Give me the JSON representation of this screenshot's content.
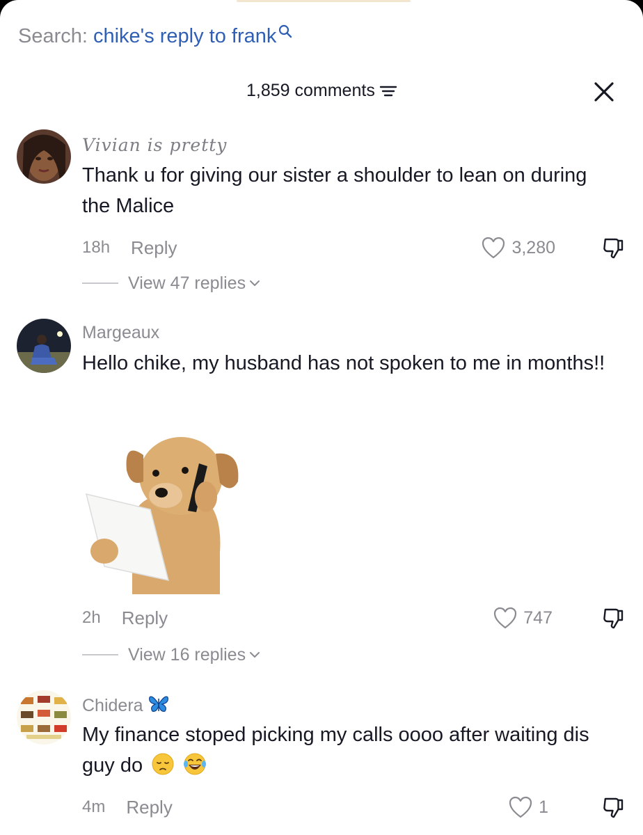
{
  "search": {
    "prefix": "Search:",
    "query": "chike's reply to frank"
  },
  "header": {
    "comment_count": "1,859 comments"
  },
  "comments": [
    {
      "username": "Vivian is pretty",
      "text": "Thank u for giving our sister a shoulder to lean on during the Malice",
      "time": "18h",
      "reply_label": "Reply",
      "likes": "3,280",
      "view_replies": "View 47 replies"
    },
    {
      "username": "Margeaux",
      "text": "Hello chike, my husband has not spoken to me in months!!",
      "time": "2h",
      "reply_label": "Reply",
      "likes": "747",
      "view_replies": "View 16 replies",
      "sticker": "puppy-on-phone-sticker"
    },
    {
      "username": "Chidera",
      "username_icon": "butterfly-icon",
      "text": "My finance stoped picking my calls oooo after waiting dis guy do",
      "emojis": [
        "pensive-face-emoji",
        "tears-of-joy-emoji"
      ],
      "time": "4m",
      "reply_label": "Reply",
      "likes": "1"
    }
  ],
  "colors": {
    "accent_link": "#2f5fb4",
    "secondary_text": "#8a8b91",
    "primary_text": "#161823"
  }
}
